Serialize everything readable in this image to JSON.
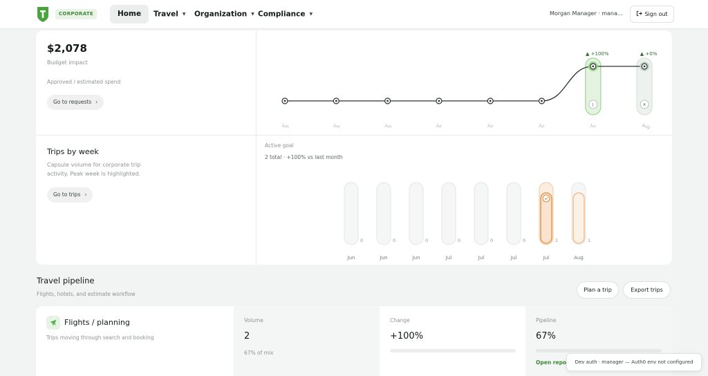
{
  "header": {
    "badge": "CORPORATE",
    "nav": [
      {
        "label": "Home"
      },
      {
        "label": "Travel"
      },
      {
        "label": "Organization"
      },
      {
        "label": "Compliance"
      }
    ],
    "user": "Morgan Manager · mana…",
    "signout": "Sign out"
  },
  "budget": {
    "amount": "$2,078",
    "label": "Budget impact",
    "note": "Approved / estimated spend",
    "link": "Go to requests"
  },
  "spend_chart": {
    "months": [
      "Jun",
      "Jun",
      "Jun",
      "Jul",
      "Jul",
      "Jul",
      "Jul",
      "Aug"
    ],
    "values": [
      0,
      0,
      0,
      0,
      0,
      0,
      1,
      1
    ],
    "highlights": [
      {
        "index": 6,
        "change": "+100%",
        "marker": "J"
      },
      {
        "index": 7,
        "change": "+0%",
        "marker": "A"
      }
    ]
  },
  "trips": {
    "title": "Trips by week",
    "desc": "Capsule volume for corporate trip activity. Peak week is highlighted.",
    "link": "Go to trips",
    "goal_label": "Active goal",
    "goal_summary": "2 total · +100% vs last month"
  },
  "trips_chart": {
    "months": [
      "Jun",
      "Jun",
      "Jun",
      "Jul",
      "Jul",
      "Jul",
      "Jul",
      "Aug"
    ],
    "values": [
      0,
      0,
      0,
      0,
      0,
      0,
      1,
      1
    ],
    "peak_index": 6
  },
  "pipeline": {
    "title": "Travel pipeline",
    "subtitle": "Flights, hotels, and estimate workflow",
    "plan": "Plan a trip",
    "export": "Export trips"
  },
  "flights": {
    "title": "Flights / planning",
    "desc": "Trips moving through search and booking",
    "volume_label": "Volume",
    "volume": "2",
    "volume_sub": "67% of mix",
    "change_label": "Change",
    "change": "+100%",
    "pipeline_label": "Pipeline",
    "pipeline": "67%",
    "pipeline_link": "Open repor"
  },
  "toast": "Dev auth · manager — Auth0 env not configured",
  "colors": {
    "brand": "#3f8a36",
    "accent_green": "#57b24d",
    "accent_orange": "#e08a3c"
  }
}
